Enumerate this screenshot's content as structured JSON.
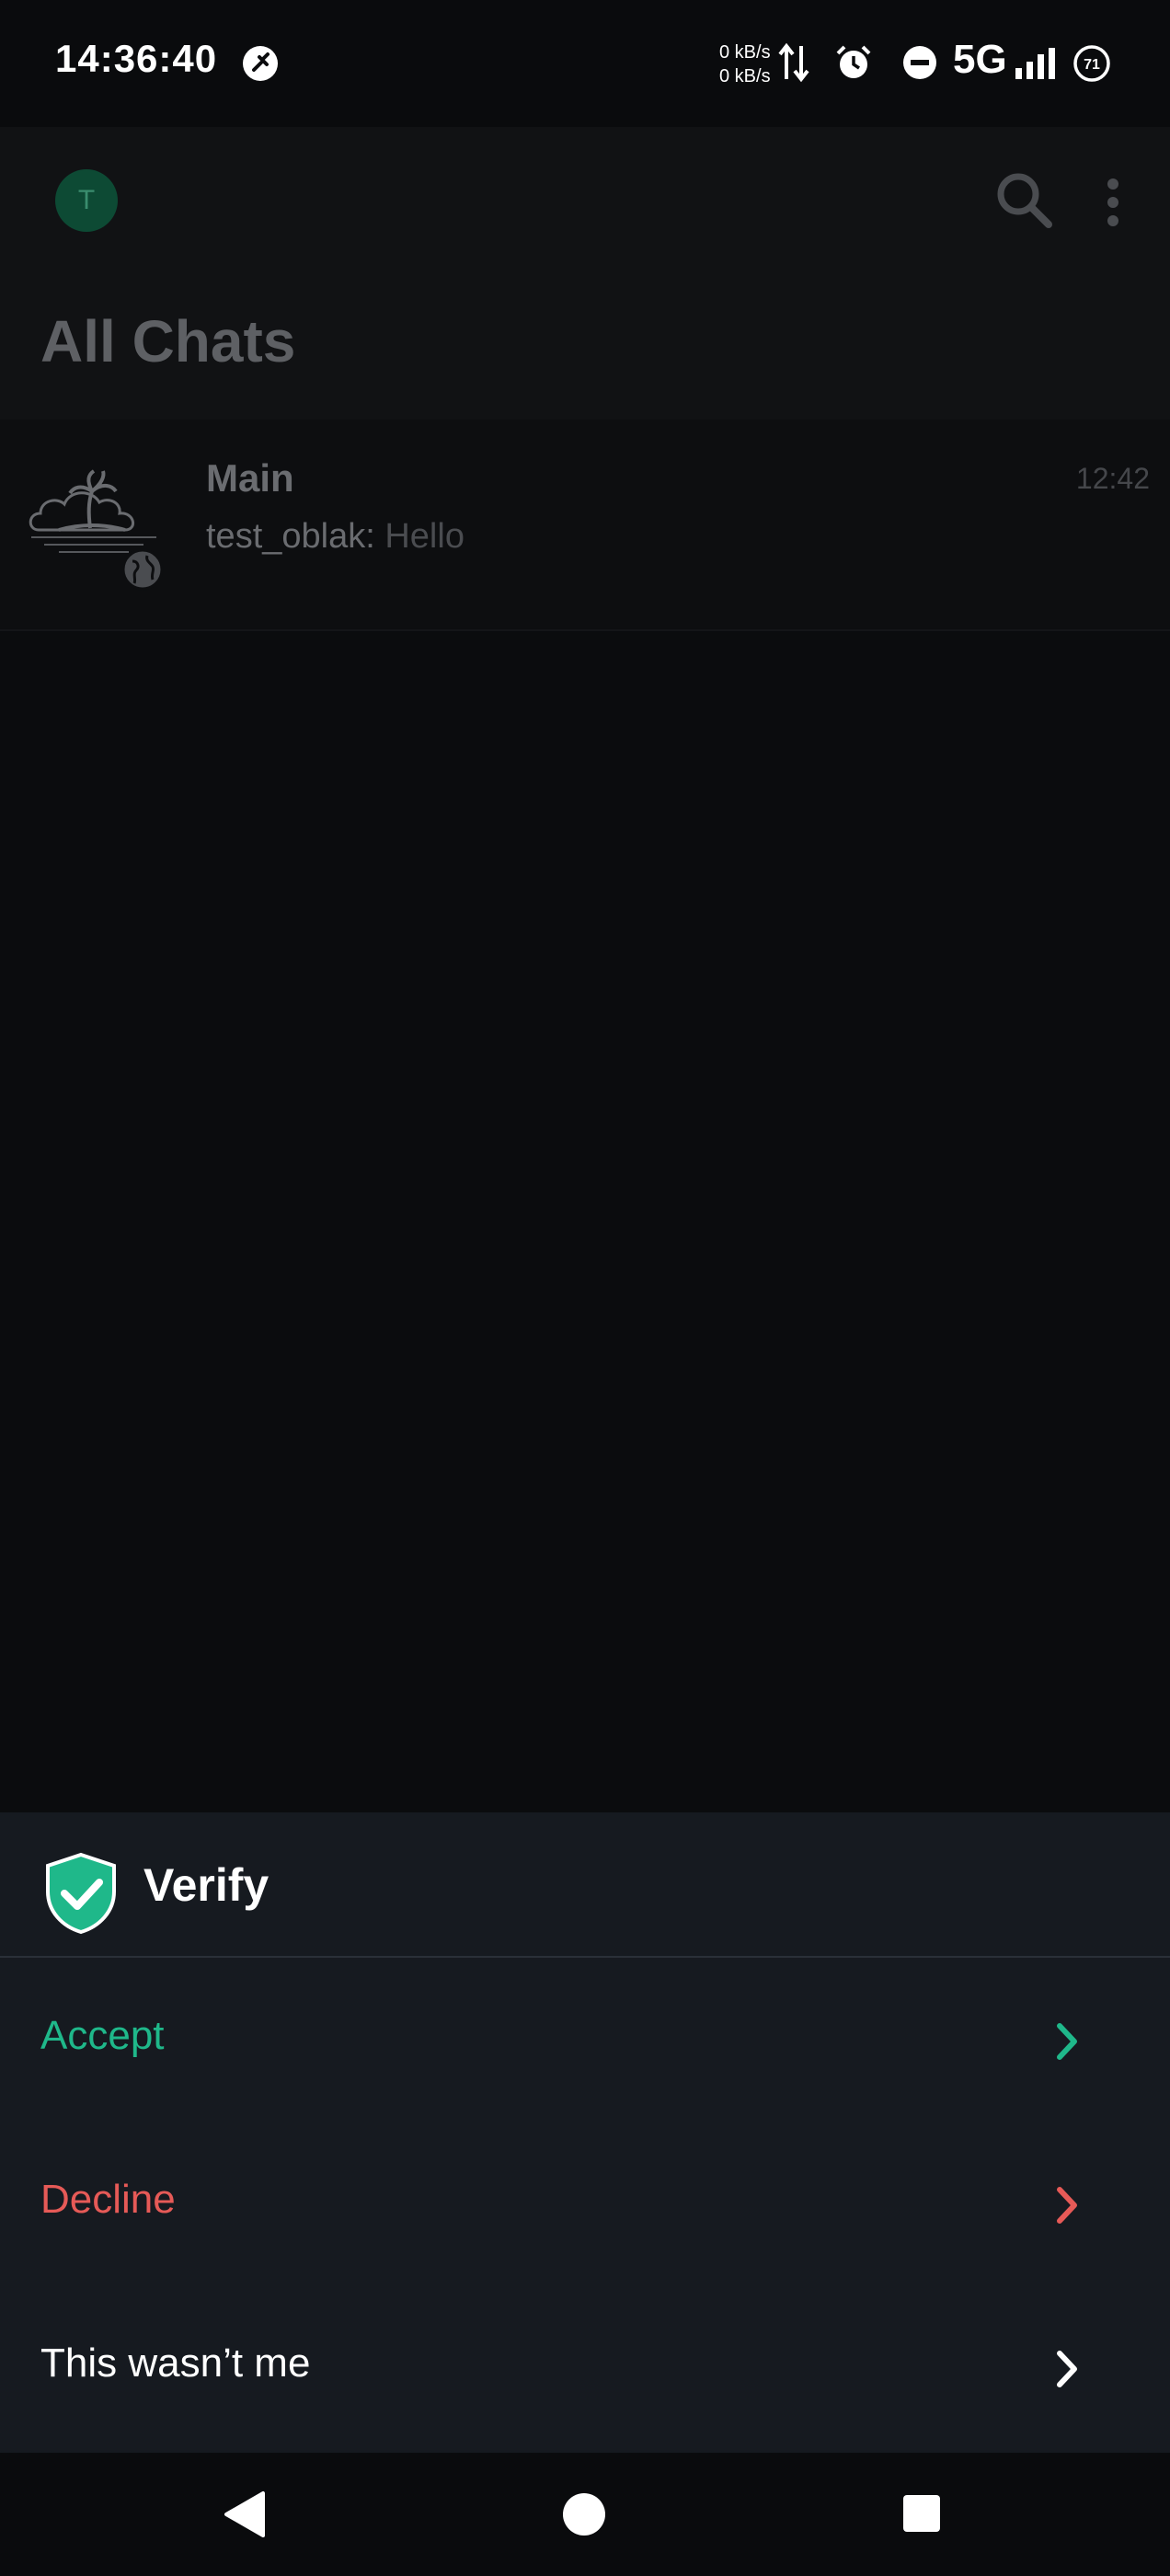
{
  "status_bar": {
    "time": "14:36:40",
    "net_up": "0 kB/s",
    "net_down": "0 kB/s",
    "network": "5G",
    "battery": "71",
    "icons": [
      "app-badge-icon",
      "data-arrows-icon",
      "alarm-icon",
      "dnd-icon",
      "signal-icon",
      "battery-icon"
    ]
  },
  "header": {
    "avatar_initial": "T",
    "title": "All Chats",
    "icons": [
      "search-icon",
      "more-vert-icon"
    ]
  },
  "chats": [
    {
      "name": "Main",
      "time": "12:42",
      "sender": "test_oblak",
      "separator": ": ",
      "message": "Hello",
      "icons": [
        "island-avatar-icon",
        "globe-icon"
      ]
    }
  ],
  "sheet": {
    "title": "Verify",
    "title_icon": "shield-check-icon",
    "options": [
      {
        "label": "Accept",
        "color": "#1fb88a"
      },
      {
        "label": "Decline",
        "color": "#e65a57"
      },
      {
        "label": "This wasn’t me",
        "color": "#ffffff"
      }
    ]
  },
  "nav": {
    "icons": [
      "back-icon",
      "home-icon",
      "recents-icon"
    ]
  },
  "colors": {
    "accent": "#1fb88a",
    "danger": "#e65a57",
    "sheet_bg": "#161a20",
    "app_bg": "#0b0c0e"
  }
}
